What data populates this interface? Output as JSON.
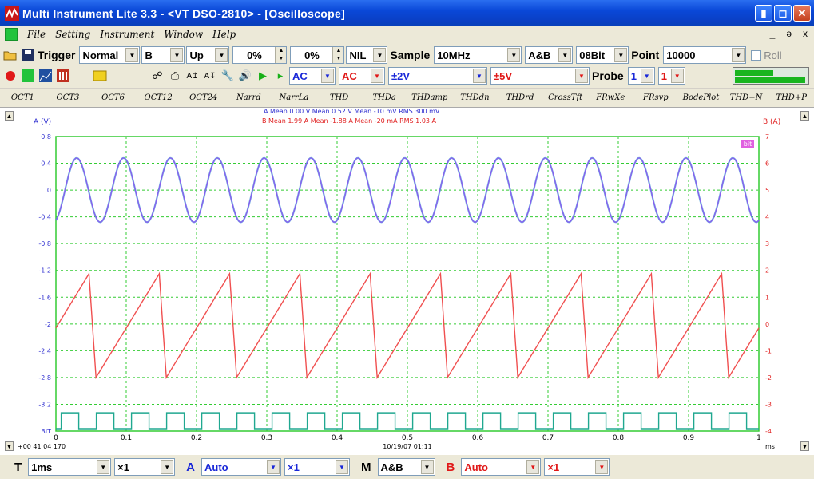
{
  "window": {
    "title": "Multi Instrument Lite 3.3   -   <VT DSO-2810> - [Oscilloscope]",
    "buttons": [
      "minimize",
      "maximize",
      "close"
    ]
  },
  "menu": {
    "items": [
      "File",
      "Setting",
      "Instrument",
      "Window",
      "Help"
    ],
    "mdi": [
      "_",
      "ə",
      "x"
    ]
  },
  "toolbar1": {
    "trigger_label": "Trigger",
    "trigger_mode": "Normal",
    "trigger_source": "B",
    "trigger_slope": "Up",
    "spin1": "0%",
    "spin2": "0%",
    "nil": "NIL",
    "sample_label": "Sample",
    "sample_rate": "10MHz",
    "channels": "A&B",
    "bits": "08Bit",
    "point_label": "Point",
    "points": "10000",
    "roll_label": "Roll"
  },
  "toolbar2": {
    "coupling_a": "AC",
    "coupling_b": "AC",
    "range_a": "±2V",
    "range_b": "±5V",
    "probe_label": "Probe",
    "probe_a": "1",
    "probe_b": "1"
  },
  "functions": [
    "OCT1",
    "OCT3",
    "OCT6",
    "OCT12",
    "OCT24",
    "Narrd",
    "NarrLa",
    "THD",
    "THDa",
    "THDamp",
    "THDdn",
    "THDrd",
    "CrossTft",
    "FRwXe",
    "FRsvp",
    "BodePlot",
    "THD+N",
    "THD+P"
  ],
  "graph": {
    "left_axis_label": "A (V)",
    "right_axis_label": "B (A)",
    "stats_line1": "A  Mean   0.00    V  Mean   0.52    V  Mean    -10 mV  RMS   300 mV",
    "stats_line2": "B  Mean   1.99    A  Mean  -1.88    A  Mean    -20 mA  RMS    1.03   A",
    "left_ticks": [
      "0.8",
      "0.4",
      "0",
      "-0.4",
      "-0.8",
      "-1.2",
      "-1.6",
      "-2",
      "-2.4",
      "-2.8",
      "-3.2",
      "BIT"
    ],
    "right_ticks": [
      "7",
      "6",
      "5",
      "4",
      "3",
      "2",
      "1",
      "0",
      "-1",
      "-2",
      "-3",
      "-4"
    ],
    "x_ticks": [
      "0",
      "0.1",
      "0.2",
      "0.3",
      "0.4",
      "0.5",
      "0.6",
      "0.7",
      "0.8",
      "0.9",
      "1"
    ],
    "x_unit": "ms",
    "timestamp": "+00 41 04 170",
    "date": "10/19/07 01:11",
    "marker": "bit",
    "colors": {
      "grid": "#33cc33",
      "sine": "#8a5cf0",
      "sine2": "#3aa0d0",
      "sawtooth": "#f05050",
      "digital": "#20a890"
    },
    "sine_amplitude_v": 0.48,
    "sine_cycles": 15,
    "saw_min_v": -2.8,
    "saw_max_v": -1.25,
    "saw_cycles": 10,
    "bit_cycles": 20
  },
  "bottom": {
    "t_label": "T",
    "timebase": "1ms",
    "t_mult": "×1",
    "a_label": "A",
    "a_scale": "Auto",
    "a_mult": "×1",
    "m_label": "M",
    "m_value": "A&B",
    "b_label": "B",
    "b_scale": "Auto",
    "b_mult": "×1"
  }
}
